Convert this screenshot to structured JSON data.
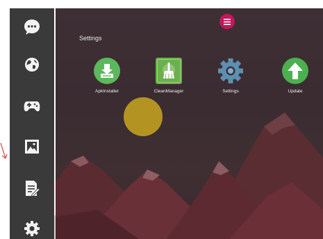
{
  "sidebar": {
    "items": [
      {
        "icon": "chat-bubble-icon"
      },
      {
        "icon": "globe-icon"
      },
      {
        "icon": "gamepad-icon"
      },
      {
        "icon": "image-icon"
      },
      {
        "icon": "document-edit-icon"
      },
      {
        "icon": "gear-icon"
      }
    ],
    "active_index": 5
  },
  "header": {
    "section_title": "Settings",
    "menu_icon": "hamburger-menu-icon"
  },
  "apps": [
    {
      "label": "ApkInstaller",
      "icon": "apk-installer-icon",
      "color": "#5cb85c"
    },
    {
      "label": "CleanManager",
      "icon": "broom-icon",
      "color": "#6ab04c"
    },
    {
      "label": "Settings",
      "icon": "gear-icon",
      "color": "#5d8fb0"
    },
    {
      "label": "Update",
      "icon": "arrow-up-icon",
      "color": "#4caf50"
    }
  ],
  "colors": {
    "sidebar": "#3a3a3a",
    "menu_button": "#c2185b",
    "sun": "#c9a61f"
  }
}
